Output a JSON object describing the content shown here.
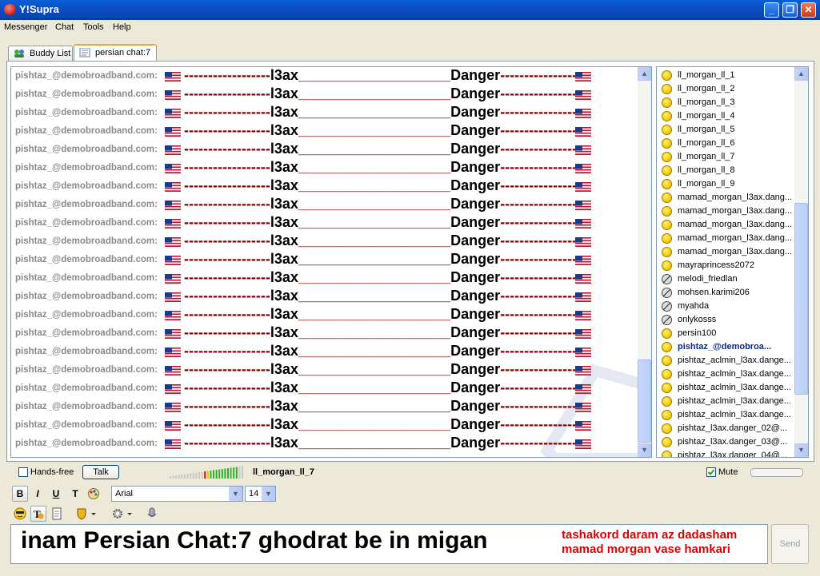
{
  "window": {
    "title": "Y!Supra"
  },
  "menu": [
    "Messenger",
    "Chat",
    "Tools",
    "Help"
  ],
  "tabs": [
    {
      "label": "Buddy List",
      "active": false
    },
    {
      "label": "persian chat:7",
      "active": true
    }
  ],
  "chat": {
    "sender": "pishtaz_@demobroadband.com:",
    "message_part1": "------------------",
    "message_word1": "l3ax",
    "message_part2": "___________________",
    "message_word2": "Danger",
    "message_part3": "-------------------",
    "row_count": 21
  },
  "users": [
    {
      "name": "ll_morgan_ll_1",
      "status": "online"
    },
    {
      "name": "ll_morgan_ll_2",
      "status": "online"
    },
    {
      "name": "ll_morgan_ll_3",
      "status": "online"
    },
    {
      "name": "ll_morgan_ll_4",
      "status": "online"
    },
    {
      "name": "ll_morgan_ll_5",
      "status": "online"
    },
    {
      "name": "ll_morgan_ll_6",
      "status": "online"
    },
    {
      "name": "ll_morgan_ll_7",
      "status": "online"
    },
    {
      "name": "ll_morgan_ll_8",
      "status": "online"
    },
    {
      "name": "ll_morgan_ll_9",
      "status": "online"
    },
    {
      "name": "mamad_morgan_l3ax.dang...",
      "status": "online"
    },
    {
      "name": "mamad_morgan_l3ax.dang...",
      "status": "online"
    },
    {
      "name": "mamad_morgan_l3ax.dang...",
      "status": "online"
    },
    {
      "name": "mamad_morgan_l3ax.dang...",
      "status": "online"
    },
    {
      "name": "mamad_morgan_l3ax.dang...",
      "status": "online"
    },
    {
      "name": "mayraprincess2072",
      "status": "online"
    },
    {
      "name": "melodi_friedlan",
      "status": "offline"
    },
    {
      "name": "mohsen.karimi206",
      "status": "offline"
    },
    {
      "name": "myahda",
      "status": "offline"
    },
    {
      "name": "onlykosss",
      "status": "offline"
    },
    {
      "name": "persin100",
      "status": "online"
    },
    {
      "name": "pishtaz_@demobroa...",
      "status": "self"
    },
    {
      "name": "pishtaz_aclmin_l3ax.dange...",
      "status": "online"
    },
    {
      "name": "pishtaz_aclmin_l3ax.dange...",
      "status": "online"
    },
    {
      "name": "pishtaz_aclmin_l3ax.dange...",
      "status": "online"
    },
    {
      "name": "pishtaz_aclmin_l3ax.dange...",
      "status": "online"
    },
    {
      "name": "pishtaz_aclmin_l3ax.dange...",
      "status": "online"
    },
    {
      "name": "pishtaz_l3ax.danger_02@...",
      "status": "online"
    },
    {
      "name": "pishtaz_l3ax.danger_03@...",
      "status": "online"
    },
    {
      "name": "pishtaz_l3ax.danger_04@...",
      "status": "online"
    }
  ],
  "voice": {
    "handsfree_label": "Hands-free",
    "talk_label": "Talk",
    "speaker": "ll_morgan_ll_7",
    "mute_label": "Mute",
    "mute_checked": true
  },
  "format": {
    "bold": "B",
    "italic": "I",
    "underline": "U",
    "text_style": "T",
    "font": "Arial",
    "size": "14"
  },
  "input": {
    "text": "inam Persian Chat:7  ghodrat be in migan",
    "note_line1": "tashakord daram az dadasham",
    "note_line2": "mamad morgan vase hamkari"
  },
  "send_label": "Send",
  "colors": {
    "title_blue": "#0b4ec1",
    "message_red": "#800000",
    "note_red": "#e00000"
  }
}
